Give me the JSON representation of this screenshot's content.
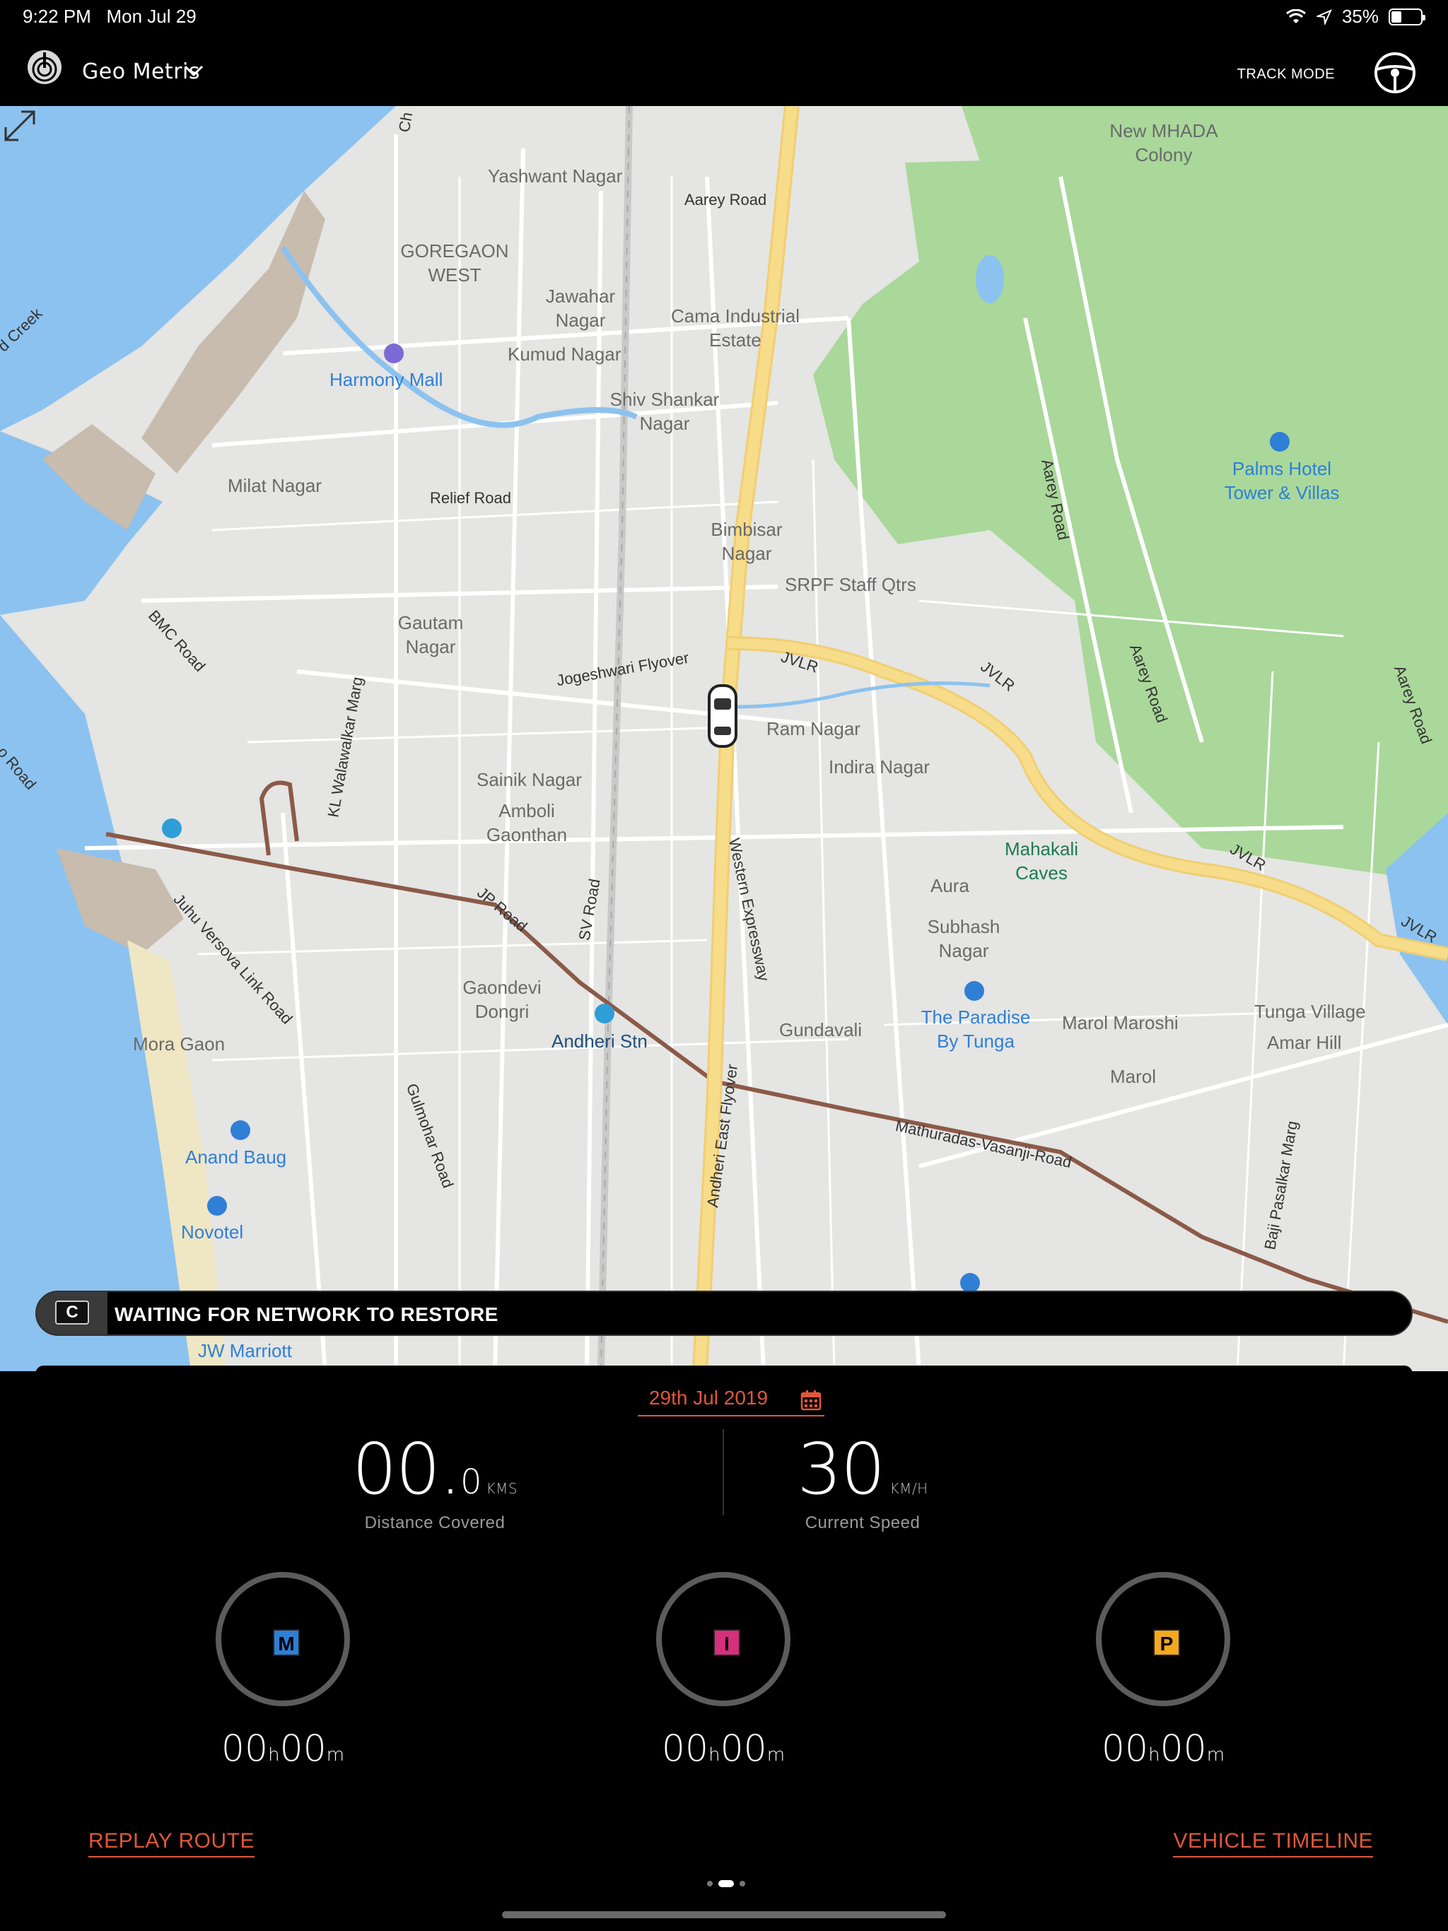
{
  "status": {
    "time": "9:22 PM",
    "date": "Mon Jul 29",
    "battery": "35%",
    "battery_level": 0.35
  },
  "header": {
    "app_title": "Geo Metris",
    "track_mode": "TRACK MODE"
  },
  "map": {
    "labels": {
      "yashwant_nagar": "Yashwant Nagar",
      "aarey_road_1": "Aarey Road",
      "new_mhada": "New MHADA Colony",
      "goregaon_west": "GOREGAON WEST",
      "jawahar_nagar": "Jawahar Nagar",
      "cama_estate": "Cama Industrial Estate",
      "kumud_nagar": "Kumud Nagar",
      "harmony_mall": "Harmony Mall",
      "shiv_shankar_nagar": "Shiv Shankar Nagar",
      "aarey_road_2": "Aarey Road",
      "palms_hotel": "Palms Hotel Tower & Villas",
      "milat_nagar": "Milat Nagar",
      "relief_road": "Relief Road",
      "bimbisar_nagar": "Bimbisar Nagar",
      "srpf": "SRPF Staff Qtrs",
      "bmc_road": "BMC Road",
      "gautam_nagar": "Gautam Nagar",
      "jogeshwari_flyover": "Jogeshwari Flyover",
      "jvlr_1": "JVLR",
      "jvlr_2": "JVLR",
      "aarey_road_3": "Aarey Road",
      "aarey_road_4": "Aarey Road",
      "ram_nagar": "Ram Nagar",
      "indira_nagar": "Indira Nagar",
      "sainik_nagar": "Sainik Nagar",
      "kl_walawalkar": "KL Walawalkar Marg",
      "amboli": "Amboli Gaonthan",
      "mahakali": "Mahakali Caves",
      "jvlr_3": "JVLR",
      "jvlr_4": "JVLR",
      "aura": "Aura",
      "jp_road": "JP Road",
      "sv_road": "SV Road",
      "western_express": "Western Expressway",
      "subhash_nagar": "Subhash Nagar",
      "juhu_versova": "Juhu Versova Link Road",
      "gaondevi": "Gaondevi Dongri",
      "paradise": "The Paradise By Tunga",
      "marol_maroshi": "Marol Maroshi",
      "tunga_village": "Tunga Village",
      "mora_gaon": "Mora Gaon",
      "andheri_stn": "Andheri Stn",
      "gundavali": "Gundavali",
      "amar_hill": "Amar Hill",
      "marol": "Marol",
      "gulmohar": "Gulmohar Road",
      "andheri_flyover": "Andheri East Flyover",
      "mathuradas": "Mathuradas-Vasanji-Road",
      "anand_baug": "Anand Baug",
      "baji_pasalkar": "Baji Pasalkar Marg",
      "novotel": "Novotel",
      "creek": "d Creek",
      "road_left": "o Road",
      "ch": "Ch",
      "jw_marriott": "JW Marriott"
    }
  },
  "banner": {
    "badge": "C",
    "text": "WAITING FOR NETWORK TO RESTORE"
  },
  "panel": {
    "date": "29th Jul 2019",
    "distance": {
      "int": "00.",
      "dec": "0",
      "unit": "KMS",
      "label": "Distance Covered"
    },
    "speed": {
      "value": "30",
      "unit": "KM/H",
      "label": "Current Speed"
    },
    "modes": [
      {
        "letter": "M",
        "color": "#2f7fd6",
        "hours": "00",
        "h": "h",
        "minutes": "00",
        "m": "m"
      },
      {
        "letter": "I",
        "color": "#d4307c",
        "hours": "00",
        "h": "h",
        "minutes": "00",
        "m": "m"
      },
      {
        "letter": "P",
        "color": "#f2a91e",
        "hours": "00",
        "h": "h",
        "minutes": "00",
        "m": "m"
      }
    ],
    "replay_label": "REPLAY ROUTE",
    "timeline_label": "VEHICLE TIMELINE"
  },
  "colors": {
    "accent": "#e0573a",
    "map_bg": "#e5e5e3",
    "water": "#8cc2ef",
    "park": "#a9d89a",
    "highway": "#f7dc8a"
  }
}
